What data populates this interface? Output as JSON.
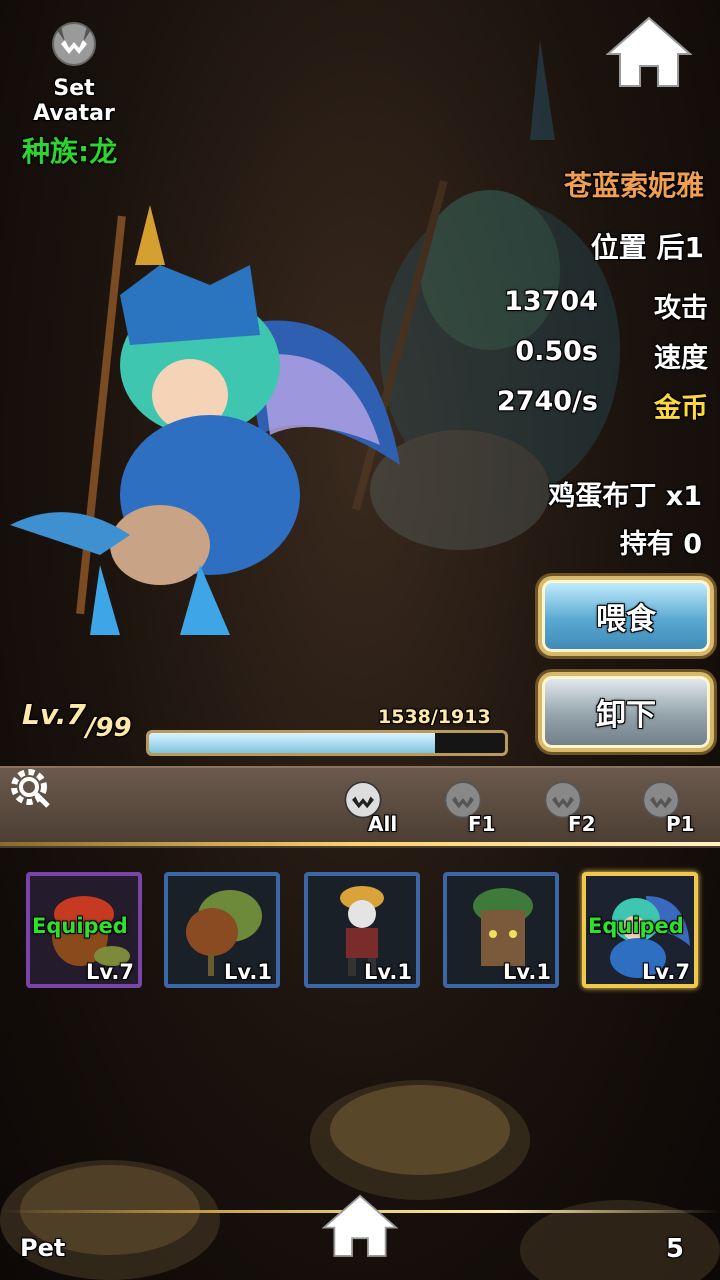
{
  "header": {
    "set_avatar_label": "Set Avatar",
    "race_label": "种族:龙"
  },
  "pet": {
    "name": "苍蓝索妮雅",
    "position": "位置 后1",
    "stats": [
      {
        "value": "13704",
        "label": "攻击"
      },
      {
        "value": "0.50s",
        "label": "速度"
      },
      {
        "value": "2740/s",
        "label": "金币"
      }
    ],
    "feed_item": "鸡蛋布丁 x1",
    "owned": "持有 0",
    "level": "Lv.7",
    "level_max": "/99",
    "exp_text": "1538/1913",
    "exp_fraction": 0.804
  },
  "buttons": {
    "feed": "喂食",
    "unequip": "卸下"
  },
  "filters": [
    {
      "label": "All"
    },
    {
      "label": "F1"
    },
    {
      "label": "F2"
    },
    {
      "label": "P1"
    }
  ],
  "slots": [
    {
      "equipped": "Equiped",
      "level": "Lv.7"
    },
    {
      "equipped": "",
      "level": "Lv.1"
    },
    {
      "equipped": "",
      "level": "Lv.1"
    },
    {
      "equipped": "",
      "level": "Lv.1"
    },
    {
      "equipped": "Equiped",
      "level": "Lv.7"
    }
  ],
  "footer": {
    "tab_label": "Pet",
    "count": "5"
  },
  "colors": {
    "race": "#2fd52f",
    "name": "#f0a050",
    "gold_label": "#ffd83a",
    "equipped": "#2fe02f",
    "selected_slot": "#f0c84a"
  },
  "icons": {
    "avatar": "wolf-head-icon",
    "home": "home-icon",
    "settings": "gear-icon",
    "filter": "wolf-head-icon"
  }
}
